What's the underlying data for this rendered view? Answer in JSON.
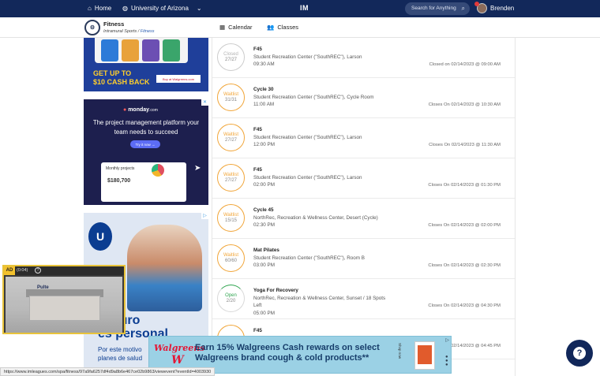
{
  "topnav": {
    "home": "Home",
    "school": "University of Arizona",
    "logo": "IM",
    "search_placeholder": "Search for Anything",
    "user": "Brenden"
  },
  "subhead": {
    "title": "Fitness",
    "crumb_parent": "Intramural Sports",
    "crumb_sep": "/",
    "crumb_active": "Fitness",
    "tab_calendar": "Calendar",
    "tab_classes": "Classes"
  },
  "classes": [
    {
      "status": "Closed",
      "count": "27/27",
      "name": "F45",
      "location": "Student Recreation Center (\"SouthREC\"), Larson",
      "extra": "",
      "time": "09:30 AM",
      "closes": "Closed on 02/14/2023 @ 09:00 AM"
    },
    {
      "status": "Waitlist",
      "count": "31/31",
      "name": "Cycle 30",
      "location": "Student Recreation Center (\"SouthREC\"), Cycle Room",
      "extra": "",
      "time": "11:00 AM",
      "closes": "Closes On 02/14/2023 @ 10:30 AM"
    },
    {
      "status": "Waitlist",
      "count": "27/27",
      "name": "F45",
      "location": "Student Recreation Center (\"SouthREC\"), Larson",
      "extra": "",
      "time": "12:00 PM",
      "closes": "Closes On 02/14/2023 @ 11:30 AM"
    },
    {
      "status": "Waitlist",
      "count": "27/27",
      "name": "F45",
      "location": "Student Recreation Center (\"SouthREC\"), Larson",
      "extra": "",
      "time": "02:00 PM",
      "closes": "Closes On 02/14/2023 @ 01:30 PM"
    },
    {
      "status": "Waitlist",
      "count": "15/15",
      "name": "Cycle 45",
      "location": "NorthRec, Recreation & Wellness Center, Desert (Cycle)",
      "extra": "",
      "time": "02:30 PM",
      "closes": "Closes On 02/14/2023 @ 02:00 PM"
    },
    {
      "status": "Waitlist",
      "count": "60/60",
      "name": "Mat Pilates",
      "location": "Student Recreation Center (\"SouthREC\"), Room B",
      "extra": "",
      "time": "03:00 PM",
      "closes": "Closes On 02/14/2023 @ 02:30 PM"
    },
    {
      "status": "Open",
      "count": "2/20",
      "name": "Yoga For Recovery",
      "location": "NorthRec, Recreation & Wellness Center, Sunset / 18 Spots",
      "extra": "Left",
      "time": "05:00 PM",
      "closes": "Closes On 02/14/2023 @ 04:30 PM"
    },
    {
      "status": "",
      "count": "",
      "name": "F45",
      "location": "",
      "extra": "",
      "time": "",
      "closes": "Closes On 02/14/2023 @ 04:45 PM"
    }
  ],
  "ads": {
    "ad1_text": "GET UP TO\n$10 CASH BACK",
    "ad1_tag": "Buy at Walgreens.com",
    "ad2_brand": "monday",
    "ad2_brand_suffix": ".com",
    "ad2_text": "The project management platform your team needs to succeed",
    "ad2_btn": "Try it now →",
    "ad2_card_title": "Monthly projects",
    "ad2_card_amount": "$180,700",
    "ad3_big": "seguro\nes personal",
    "ad3_small": "Por este motivo\nplanes de salud",
    "video_label": "AD",
    "video_time": "(0:04)",
    "video_info": "?",
    "video_brand": "Pulte",
    "banner_brand": "Walgreens",
    "banner_w": "W",
    "banner_copy": "Earn 15% Walgreens Cash rewards on select Walgreens brand cough & cold products**",
    "banner_shop": "Shop now",
    "ad_x": "✕",
    "ad_choices": "▷"
  },
  "status_url": "https://www.imleagues.com/spa/fitness/97a9fa6257df4d9a8b6e467ce02b9863/viewevent?eventId=4003930",
  "colors": {
    "nav": "#12285a",
    "waitlist": "#f1a63a",
    "open": "#2ea44f",
    "closed": "#b3b3b3"
  }
}
